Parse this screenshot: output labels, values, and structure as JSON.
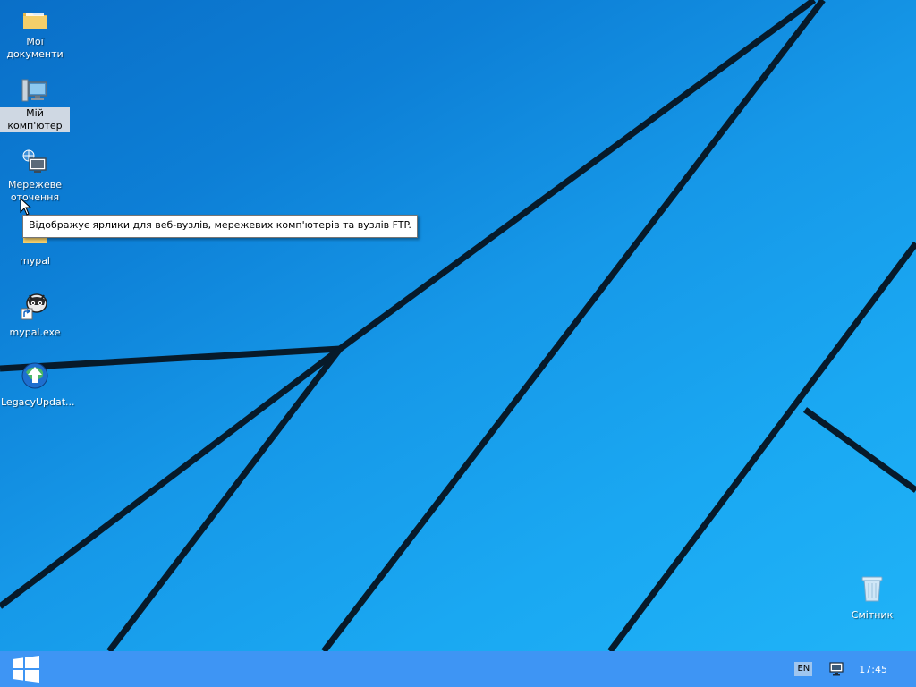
{
  "desktop": {
    "icons": [
      {
        "label": "Мої документи",
        "icon": "folder-icon"
      },
      {
        "label": "Мій комп'ютер",
        "icon": "computer-icon",
        "selected": true
      },
      {
        "label": "Мережеве оточення",
        "icon": "network-icon"
      },
      {
        "label": "mypal",
        "icon": "folder-icon"
      },
      {
        "label": "mypal.exe",
        "icon": "mypal-shortcut-icon"
      },
      {
        "label": "LegacyUpdat...",
        "icon": "legacy-update-icon"
      },
      {
        "label": "Смітник",
        "icon": "recycle-bin-icon"
      }
    ],
    "tooltip": "Відображує ярлики для веб-вузлів, мережевих комп'ютерів та вузлів FTP."
  },
  "taskbar": {
    "start_icon": "windows-logo-icon",
    "tray": {
      "language": "EN",
      "network_icon": "network-tray-icon",
      "clock": "17:45"
    }
  },
  "colors": {
    "taskbar": "#3e95f4",
    "wallpaper_light": "#20b3f7",
    "wallpaper_dark": "#0a6fc8"
  }
}
